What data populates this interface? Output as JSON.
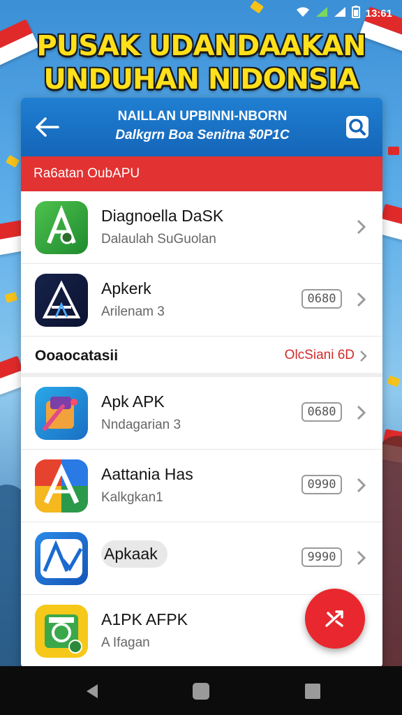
{
  "status_bar": {
    "time": "13:61"
  },
  "headline": {
    "line1": "PUSAK UDANDAAKAN",
    "line2": "UNDUHAN NIDONSIA"
  },
  "app_bar": {
    "title": "NAILLAN UPBINNI-NBORN",
    "subtitle": "Dalkgrn Boa Senitna $0P1C"
  },
  "section_banner": "Ra6atan OubAPU",
  "apps_top": [
    {
      "name": "Diagnoella DaSK",
      "subtitle": "Dalaulah SuGuolan",
      "badge": ""
    },
    {
      "name": "Apkerk",
      "subtitle": "Arilenam 3",
      "badge": "0680"
    }
  ],
  "category_row": {
    "label": "Ooaocatasii",
    "action": "OlcSiani 6D"
  },
  "apps_bottom": [
    {
      "name": "Apk APK",
      "subtitle": "Nndagarian 3",
      "badge": "0680"
    },
    {
      "name": "Aattania Has",
      "subtitle": "Kalkgkan1",
      "badge": "0990"
    },
    {
      "name": "Apkaak",
      "subtitle": "",
      "badge": "9990"
    },
    {
      "name": "A1PK AFPK",
      "subtitle": "A Ifagan",
      "badge": ""
    }
  ],
  "colors": {
    "app_bar": "#1565b8",
    "banner_red": "#e23232",
    "fab_red": "#e8282e",
    "headline_yellow": "#ffe01a"
  },
  "icons": [
    "back-arrow-icon",
    "search-icon",
    "chevron-right-icon",
    "shuffle-icon",
    "wifi-icon",
    "signal-icon",
    "battery-icon"
  ]
}
